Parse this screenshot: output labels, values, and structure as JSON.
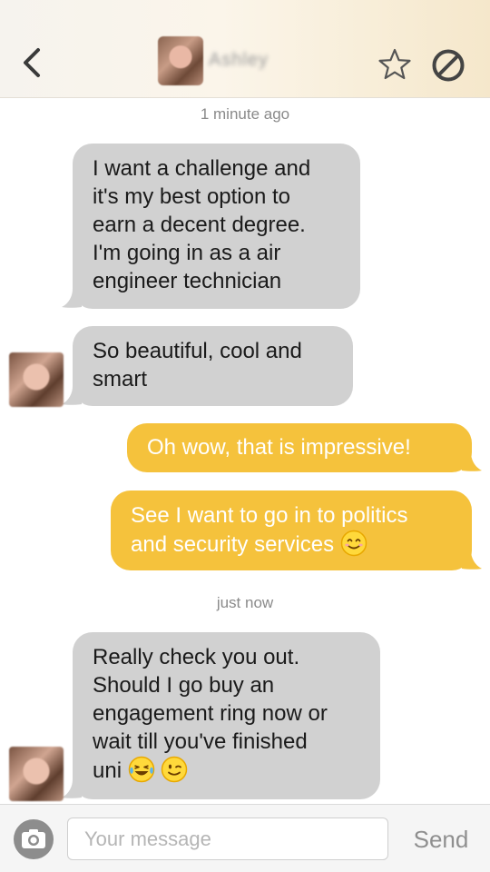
{
  "header": {
    "contact_name": "Ashley",
    "back_icon": "chevron-left-icon",
    "favorite_icon": "star-outline-icon",
    "block_icon": "block-icon"
  },
  "conversation": {
    "timestamp_1": "1 minute ago",
    "msg_1": {
      "direction": "incoming",
      "lines": [
        "I want a challenge and",
        "it's my best option to",
        "earn a decent degree.",
        "I'm going in as a air",
        "engineer technician"
      ]
    },
    "msg_2": {
      "direction": "incoming",
      "lines": [
        "So beautiful, cool and",
        "smart"
      ]
    },
    "msg_3": {
      "direction": "outgoing",
      "lines": [
        "Oh wow, that is impressive!"
      ]
    },
    "msg_4": {
      "direction": "outgoing",
      "lines": [
        "See I want to go in to politics",
        "and security services"
      ],
      "emoji": "smiling-face-emoji"
    },
    "timestamp_2": "just now",
    "msg_5": {
      "direction": "incoming",
      "lines": [
        "Really check you out.",
        "Should I go buy an",
        "engagement ring now or",
        "wait till you've finished",
        "uni"
      ],
      "emojis": [
        "tears-of-joy-emoji",
        "winking-face-emoji"
      ]
    }
  },
  "composer": {
    "camera_icon": "camera-icon",
    "placeholder": "Your message",
    "value": "",
    "send_label": "Send"
  },
  "colors": {
    "incoming_bubble": "#d1d1d1",
    "outgoing_bubble": "#f5c23c",
    "outgoing_text": "#ffffff"
  }
}
